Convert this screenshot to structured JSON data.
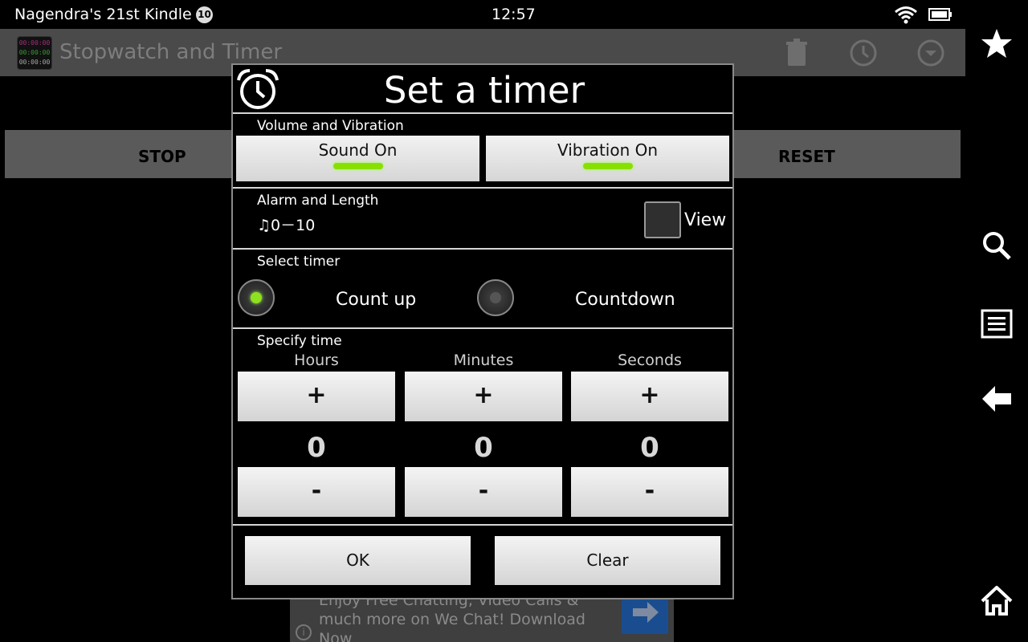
{
  "status_bar": {
    "device_name": "Nagendra's 21st Kindle",
    "notification_count": "10",
    "time": "12:57"
  },
  "app_bar": {
    "title": "Stopwatch and Timer",
    "logo_lines": [
      "00:00:00",
      "00:00:00",
      "00:00:00"
    ],
    "icons": [
      "trash-icon",
      "clock-icon",
      "dropdown-icon"
    ]
  },
  "background": {
    "stop_label": "STOP",
    "reset_label": "RESET"
  },
  "ad": {
    "text": "Enjoy Free Chatting, Video Calls & much more on We Chat! Download Now",
    "info": "i"
  },
  "dialog": {
    "title": "Set a timer",
    "volume_section": {
      "label": "Volume and Vibration",
      "sound_label": "Sound On",
      "vibration_label": "Vibration On",
      "sound_on": true,
      "vibration_on": true
    },
    "alarm_section": {
      "label": "Alarm and Length",
      "value": "♫0－10",
      "view_label": "View",
      "view_checked": false
    },
    "timer_section": {
      "label": "Select timer",
      "options": [
        {
          "label": "Count up",
          "selected": true
        },
        {
          "label": "Countdown",
          "selected": false
        }
      ]
    },
    "time_section": {
      "label": "Specify time",
      "units": [
        {
          "label": "Hours",
          "value": "0",
          "plus": "+",
          "minus": "-"
        },
        {
          "label": "Minutes",
          "value": "0",
          "plus": "+",
          "minus": "-"
        },
        {
          "label": "Seconds",
          "value": "0",
          "plus": "+",
          "minus": "-"
        }
      ]
    },
    "ok_label": "OK",
    "clear_label": "Clear"
  },
  "colors": {
    "indicator_on": "#88e000",
    "radio_selected": "#8fe020",
    "radio_unselected": "#555555"
  },
  "nav_bar": {
    "icons": [
      "star-icon",
      "search-icon",
      "menu-icon",
      "back-icon",
      "home-icon"
    ]
  }
}
